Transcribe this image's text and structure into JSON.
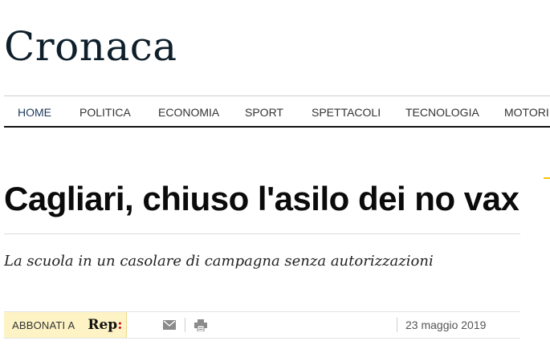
{
  "section": {
    "title": "Cronaca"
  },
  "nav": {
    "items": [
      {
        "label": "HOME",
        "active": true
      },
      {
        "label": "POLITICA"
      },
      {
        "label": "ECONOMIA"
      },
      {
        "label": "SPORT"
      },
      {
        "label": "SPETTACOLI"
      },
      {
        "label": "TECNOLOGIA"
      },
      {
        "label": "MOTORI"
      }
    ]
  },
  "article": {
    "headline": "Cagliari, chiuso l'asilo dei no vax",
    "subtitle": "La scuola in un casolare di campagna senza autorizzazioni",
    "date": "23 maggio 2019"
  },
  "toolbar": {
    "subscribe_label": "ABBONATI A",
    "logo_text": "Rep",
    "logo_colon": ":",
    "icons": [
      "mail-icon",
      "print-icon"
    ]
  },
  "colors": {
    "section_title": "#0e1f2b",
    "nav_active": "#1f3a5c",
    "subscribe_bg": "#fdf3c5",
    "logo_accent": "#d20a11",
    "accent": "#f5c400"
  }
}
